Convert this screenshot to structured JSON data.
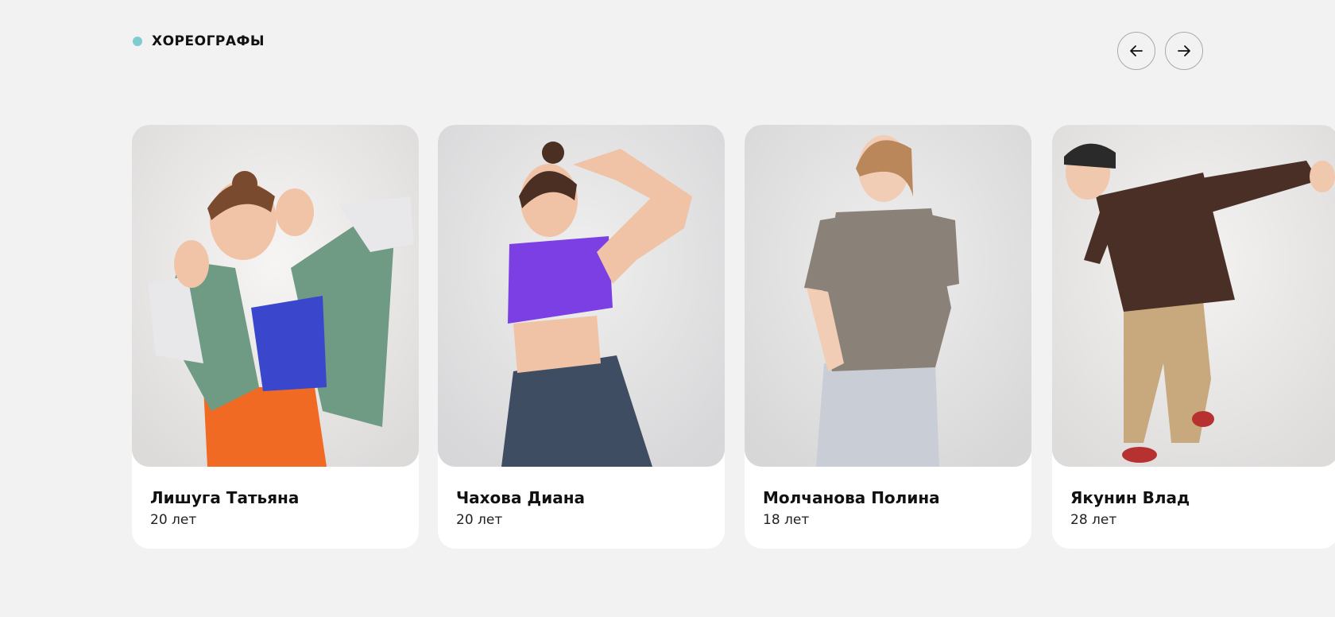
{
  "section": {
    "title": "ХОРЕОГРАФЫ",
    "accent_color": "#7ecbd0"
  },
  "nav": {
    "prev_icon": "arrow-left-icon",
    "next_icon": "arrow-right-icon"
  },
  "choreographers": [
    {
      "name": "Лишуга Татьяна",
      "age": "20 лет"
    },
    {
      "name": "Чахова Диана",
      "age": "20 лет"
    },
    {
      "name": "Молчанова Полина",
      "age": "18 лет"
    },
    {
      "name": "Якунин Влад",
      "age": "28 лет"
    }
  ]
}
